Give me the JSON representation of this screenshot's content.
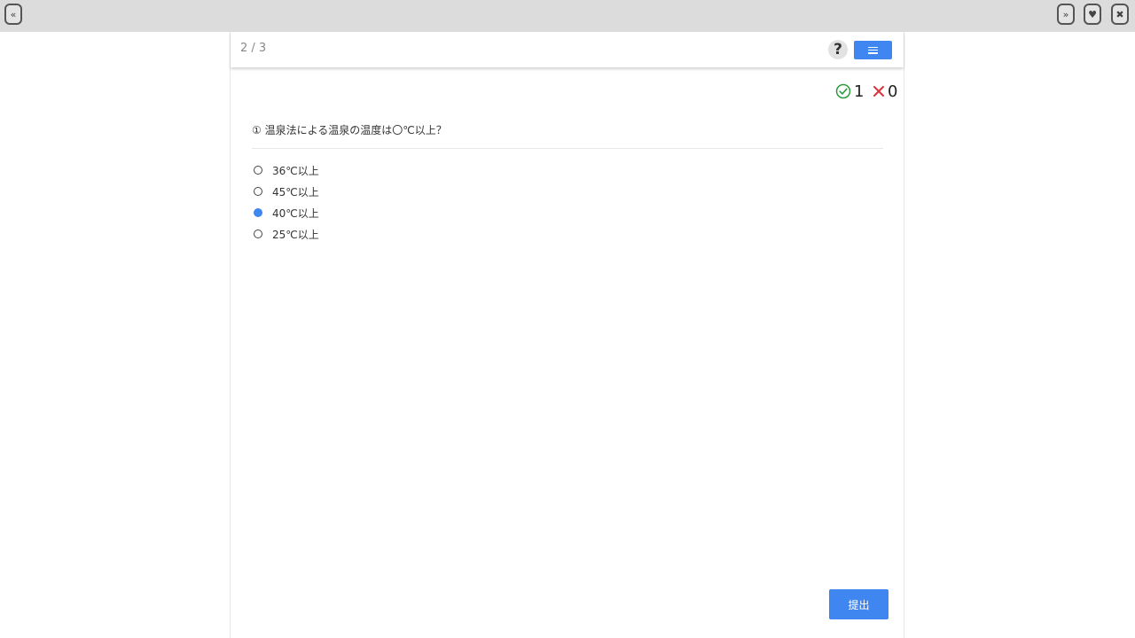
{
  "window": {
    "left_button_glyph": "«",
    "right_buttons": [
      {
        "icon": "double-chevron-right-icon",
        "glyph": "»"
      },
      {
        "icon": "heart-icon",
        "glyph": "♥"
      },
      {
        "icon": "close-icon",
        "glyph": "✖"
      }
    ]
  },
  "quiz": {
    "progress": "2 / 3",
    "help_glyph": "?",
    "score": {
      "correct": "1",
      "wrong": "0",
      "correct_color": "#2e9a3e",
      "wrong_color": "#d8353a"
    },
    "question": "① 温泉法による温泉の温度は〇℃以上？",
    "options": [
      {
        "label": "36℃以上",
        "selected": false
      },
      {
        "label": "45℃以上",
        "selected": false
      },
      {
        "label": "40℃以上",
        "selected": true
      },
      {
        "label": "25℃以上",
        "selected": false
      }
    ],
    "submit_label": "提出"
  },
  "colors": {
    "accent": "#3f86f1",
    "topbar": "#dcdcdc"
  }
}
